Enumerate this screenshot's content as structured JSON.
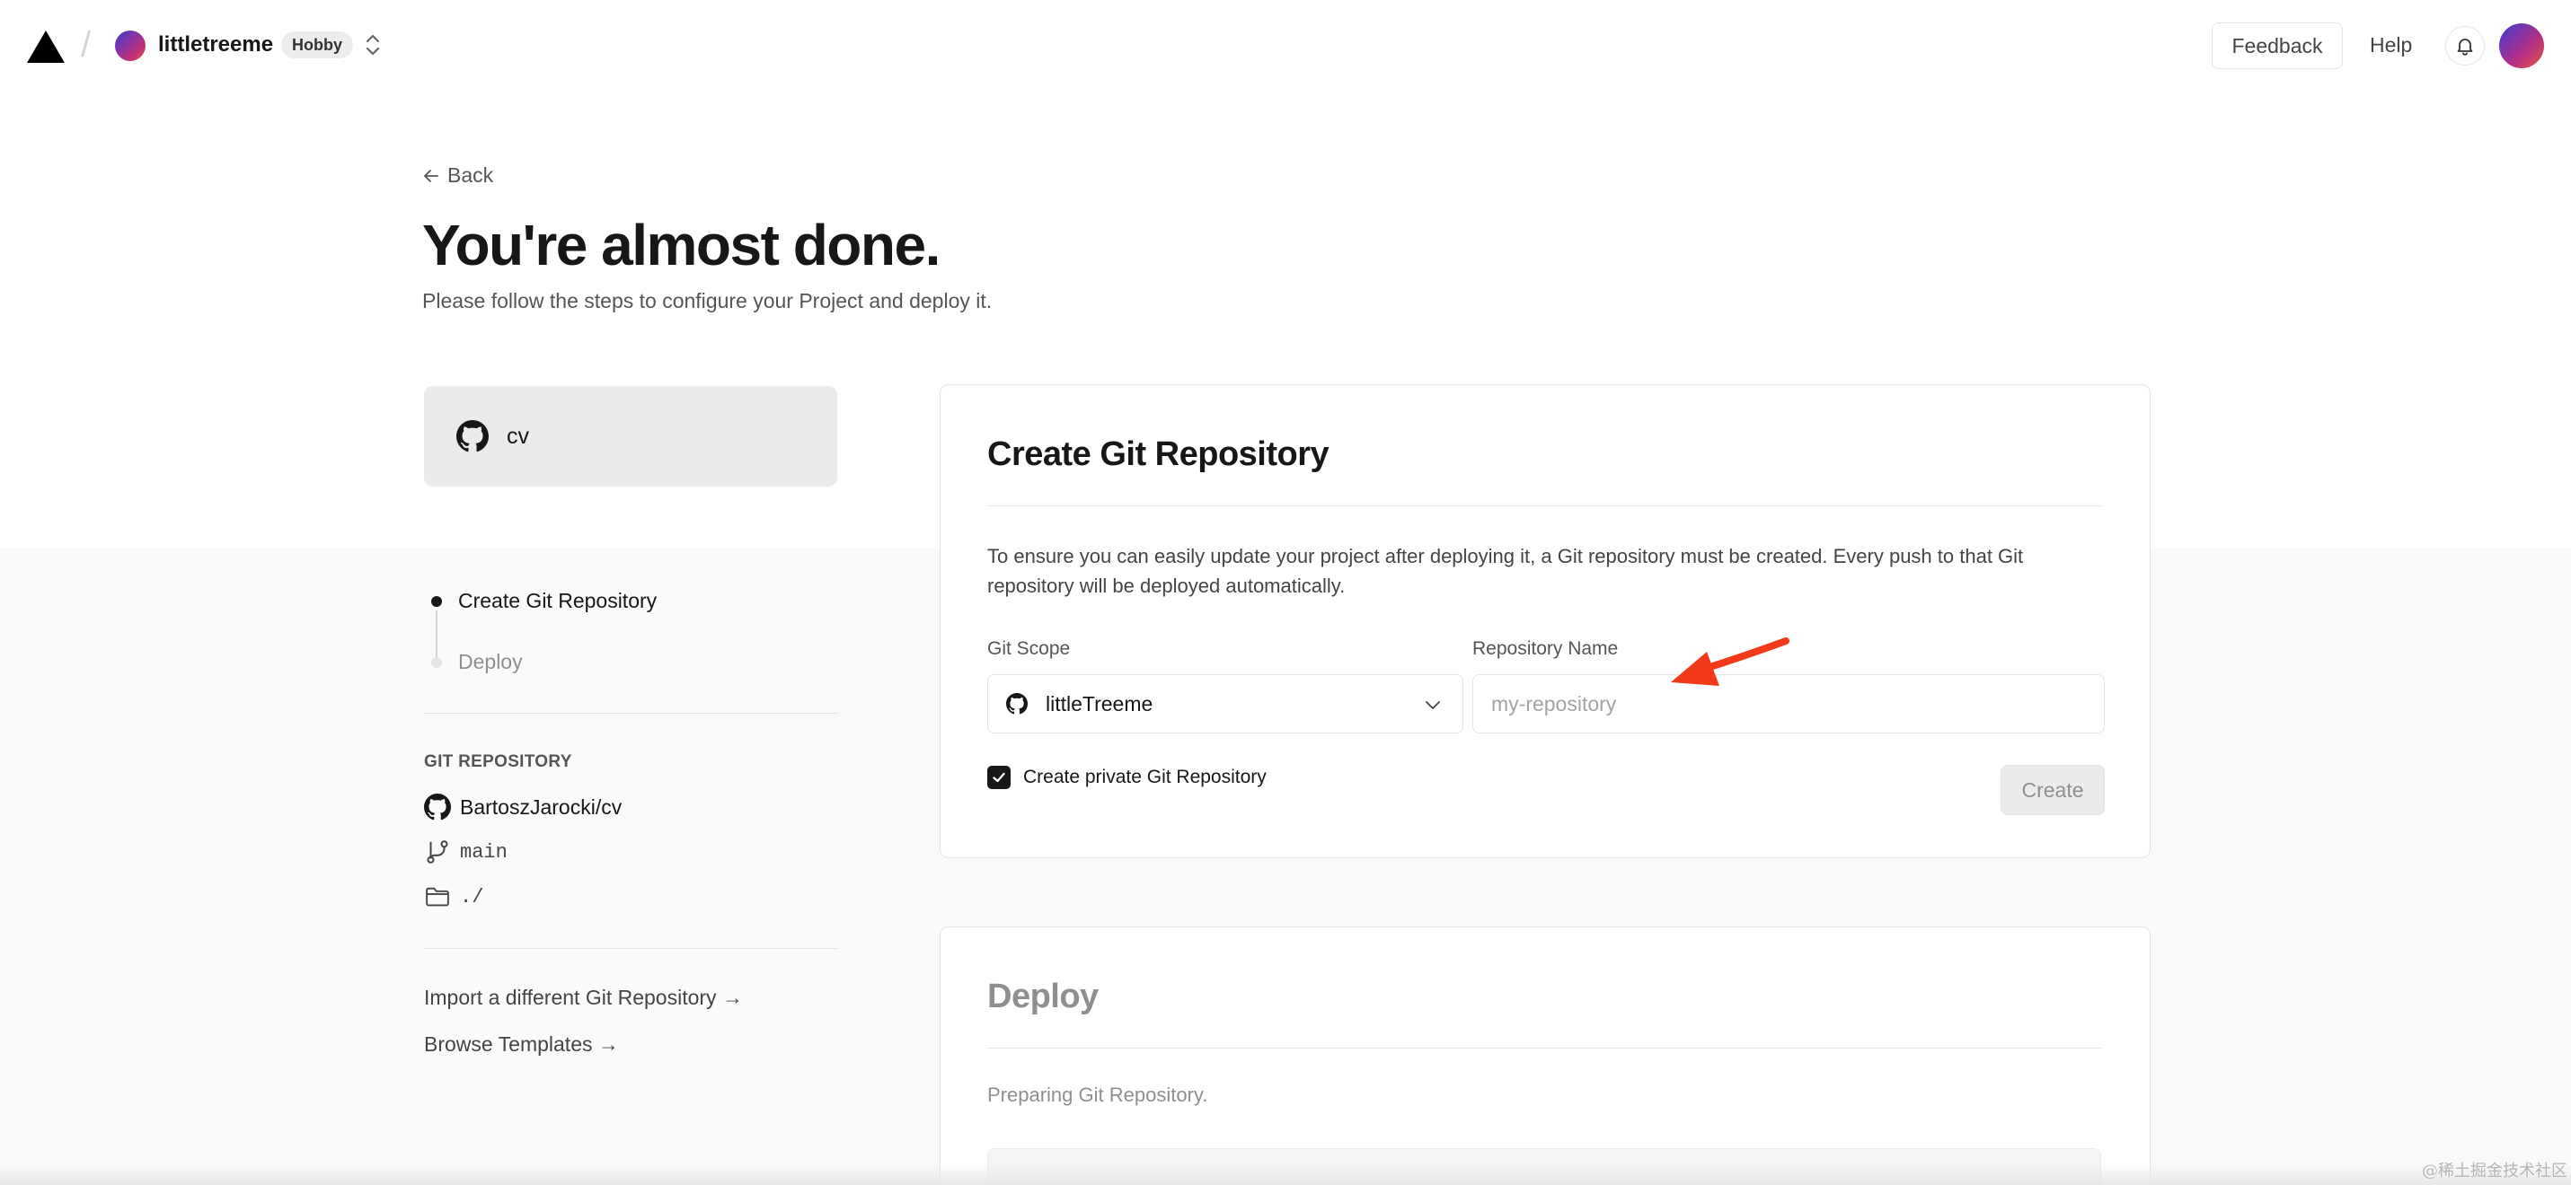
{
  "header": {
    "team_name": "littletreeme",
    "plan_badge": "Hobby",
    "feedback_label": "Feedback",
    "help_label": "Help"
  },
  "page": {
    "back_label": "Back",
    "title": "You're almost done.",
    "subtitle": "Please follow the steps to configure your Project and deploy it."
  },
  "sidebar": {
    "repo_card_name": "cv",
    "steps": [
      {
        "label": "Create Git Repository",
        "active": true
      },
      {
        "label": "Deploy",
        "active": false
      }
    ],
    "section_label": "GIT REPOSITORY",
    "repo_full_name": "BartoszJarocki/cv",
    "branch": "main",
    "root_dir": "./",
    "links": [
      "Import a different Git Repository →",
      "Browse Templates →"
    ]
  },
  "create_card": {
    "title": "Create Git Repository",
    "description": "To ensure you can easily update your project after deploying it, a Git repository must be created. Every push to that Git repository will be deployed automatically.",
    "git_scope_label": "Git Scope",
    "git_scope_value": "littleTreeme",
    "repo_name_label": "Repository Name",
    "repo_name_value": "",
    "repo_name_placeholder": "my-repository",
    "private_checkbox_label": "Create private Git Repository",
    "private_checked": true,
    "create_button_label": "Create"
  },
  "deploy_card": {
    "title": "Deploy",
    "description": "Preparing Git Repository."
  },
  "watermark": "@稀土掘金技术社区",
  "colors": {
    "annotation_arrow": "#f2391a",
    "text_primary": "#171717",
    "text_muted": "#8f8f8f"
  },
  "icons": [
    "vercel-logo-icon",
    "chevron-up-down-icon",
    "bell-icon",
    "arrow-left-icon",
    "github-icon",
    "git-branch-icon",
    "folder-icon",
    "chevron-down-icon",
    "check-icon",
    "annotation-arrow-icon"
  ]
}
